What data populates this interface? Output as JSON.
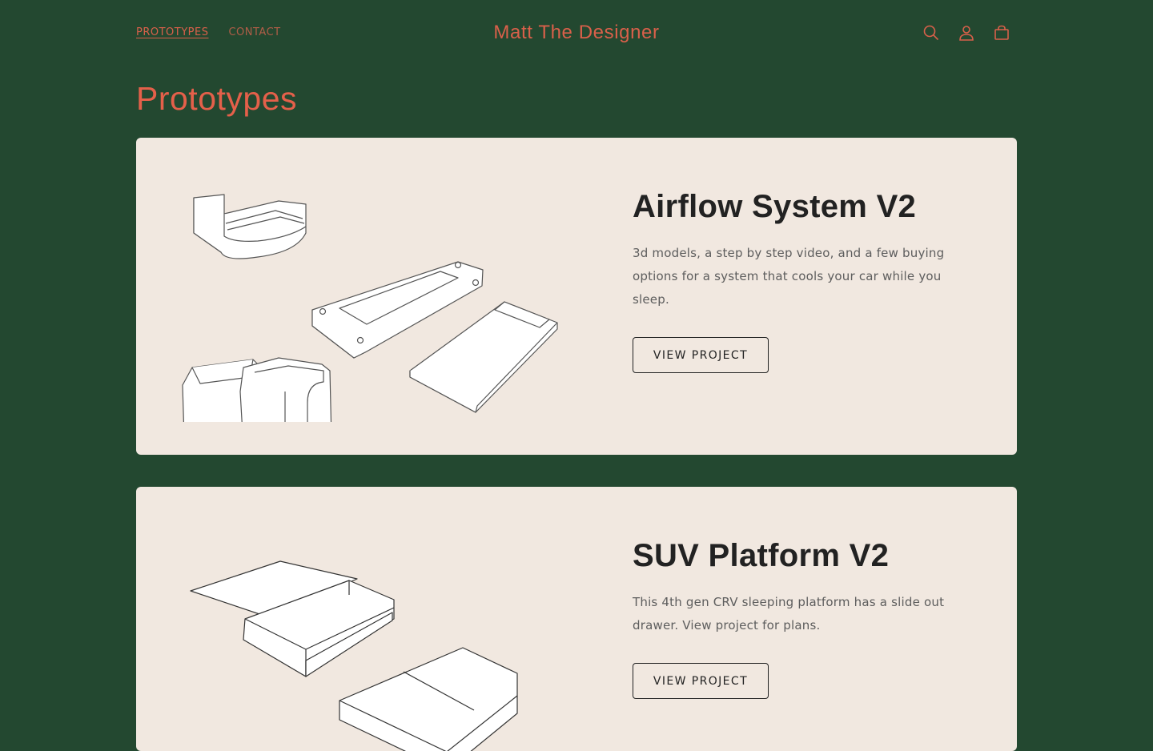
{
  "header": {
    "nav": [
      {
        "label": "PROTOTYPES"
      },
      {
        "label": "CONTACT"
      }
    ],
    "site_title": "Matt The Designer",
    "icons": [
      "search-icon",
      "account-icon",
      "cart-icon"
    ]
  },
  "page": {
    "title": "Prototypes"
  },
  "projects": [
    {
      "title": "Airflow System V2",
      "description": "3d models, a step by step video, and a few buying options for a system that cools your car while you sleep.",
      "button_label": "VIEW PROJECT"
    },
    {
      "title": "SUV Platform V2",
      "description": "This 4th gen CRV sleeping platform has a slide out drawer. View project for plans.",
      "button_label": "VIEW PROJECT"
    }
  ],
  "colors": {
    "background": "#234830",
    "accent": "#d9604a",
    "card": "#f1e8e0",
    "text_dark": "#222222"
  }
}
